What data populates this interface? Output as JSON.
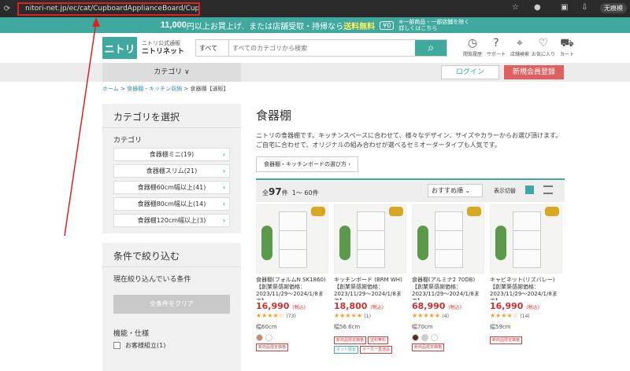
{
  "browser": {
    "url": "nitori-net.jp/ec/cat/CupboardApplianceBoard/Cupboard/1/",
    "guest_label": "无痕模"
  },
  "banner": {
    "amount": "11,000",
    "text": "円以上お買上げ、または店舗受取・持帰なら",
    "free": "送料無料",
    "badge": "¥0",
    "note1": "※一部商品・一部店舗を除く",
    "note2": "詳しくはこちら"
  },
  "header": {
    "logo": "ニトリ",
    "sub": "ニトリ公式通販",
    "brand": "ニトリネット",
    "search_scope": "すべて",
    "search_placeholder": "すべてのカテゴリから検索",
    "icons": [
      {
        "label": "閲覧履歴",
        "glyph": "◷"
      },
      {
        "label": "サポート",
        "glyph": "?"
      },
      {
        "label": "店舗検索",
        "glyph": "⌖"
      },
      {
        "label": "お気に入り",
        "glyph": "♡"
      },
      {
        "label": "カート",
        "glyph": "⛟"
      }
    ]
  },
  "nav": {
    "category": "カテゴリ ∨",
    "login": "ログイン",
    "register": "新規会員登録"
  },
  "breadcrumb": {
    "home": "ホーム",
    "mid": "食器棚・キッチン収納",
    "current": "食器棚【通販】",
    "sep": ">"
  },
  "sidebar": {
    "select_title": "カテゴリを選択",
    "category_label": "カテゴリ",
    "categories": [
      "食器棚ミニ(19)",
      "食器棚スリム(21)",
      "食器棚60cm幅以上(41)",
      "食器棚80cm幅以上(14)",
      "食器棚120cm幅以上(3)"
    ],
    "filter_title": "条件で絞り込む",
    "current_label": "現在絞り込んでいる条件",
    "clear_label": "全条件をクリア",
    "feature_label": "機能・仕様",
    "feature_option": "お客様組立(1)"
  },
  "main": {
    "title": "食器棚",
    "desc": "ニトリの食器棚です。キッチンスペースに合わせて、様々なデザイン、サイズやカラーからお選び頂けます。ご自宅に合わせて、オリジナルの組み合わせが選べるセミオーダータイプも人気です。",
    "guide": "食器棚・キッチンボードの選び方 ›",
    "count_prefix": "全",
    "count": "97",
    "count_suffix": "件",
    "range": "1〜 60件",
    "sort": "おすすめ順 ⌄",
    "view_label": "表示切替"
  },
  "products": [
    {
      "name": "食器棚(フォルムN SK1860)【創業祭感謝価格：2023/11/29〜2024/1/8まで】",
      "price": "16,990",
      "tax": "(税込)",
      "stars": "★★★★☆",
      "reviews": "(73)",
      "size": "幅60cm",
      "colors": [
        "#c98a6a",
        "#ffffff"
      ],
      "tags": [
        {
          "t": "新商品限定価格",
          "g": false
        }
      ]
    },
    {
      "name": "キッチンボード (BRM WH)【創業祭感謝価格：2023/11/29〜2024/1/8まで】",
      "price": "18,800",
      "tax": "(税込)",
      "stars": "★★★★★",
      "reviews": "(1)",
      "size": "幅56.6cm",
      "colors": [],
      "tags": [
        {
          "t": "新商品限定価格",
          "g": false
        },
        {
          "t": "送料無料",
          "g": false
        },
        {
          "t": "ネット限定",
          "g": true
        },
        {
          "t": "メーカー直送品",
          "g": false
        }
      ]
    },
    {
      "name": "食器棚(アルミナ2 70DB)【創業祭感謝価格：2023/11/29〜2024/1/8まで】",
      "price": "68,990",
      "tax": "(税込)",
      "stars": "★★★★★",
      "reviews": "(4)",
      "size": "幅70cm",
      "colors": [
        "#5a2e1e",
        "#cccccc",
        "#ffffff"
      ],
      "tags": [
        {
          "t": "新商品限定価格",
          "g": false
        }
      ]
    },
    {
      "name": "キャビネット(リズバレー)【創業祭感謝価格：2023/11/29〜2024/1/8まで】",
      "price": "16,990",
      "tax": "(税込)",
      "stars": "★★★★☆",
      "reviews": "(14)",
      "size": "幅59cm",
      "colors": [],
      "tags": [
        {
          "t": "新商品限定価格",
          "g": false
        }
      ]
    }
  ]
}
